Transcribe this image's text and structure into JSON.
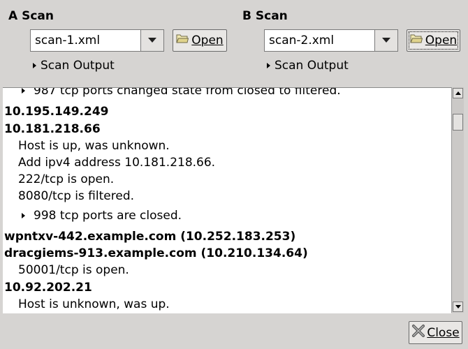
{
  "a_scan": {
    "title": "A Scan",
    "file": "scan-1.xml",
    "open_label": "Open",
    "output_label": "Scan Output"
  },
  "b_scan": {
    "title": "B Scan",
    "file": "scan-2.xml",
    "open_label": "Open",
    "output_label": "Scan Output"
  },
  "diff": {
    "partial_top": "987 tcp ports changed state from closed to filtered.",
    "host1": "10.195.149.249",
    "host2": "10.181.218.66",
    "host2_lines": [
      "Host is up, was unknown.",
      "Add ipv4 address 10.181.218.66.",
      "222/tcp is open.",
      "8080/tcp is filtered."
    ],
    "host2_closed": "998 tcp ports are closed.",
    "host3": "wpntxv-442.example.com (10.252.183.253)",
    "host4": "dracgiems-913.example.com (10.210.134.64)",
    "host4_lines": [
      "50001/tcp is open."
    ],
    "host5": "10.92.202.21",
    "host5_lines": [
      "Host is unknown, was up."
    ]
  },
  "close_label": "Close",
  "icons": {
    "open": "folder-icon",
    "combo": "chevron-down-icon",
    "expander": "triangle-right-icon",
    "close": "x-icon"
  }
}
